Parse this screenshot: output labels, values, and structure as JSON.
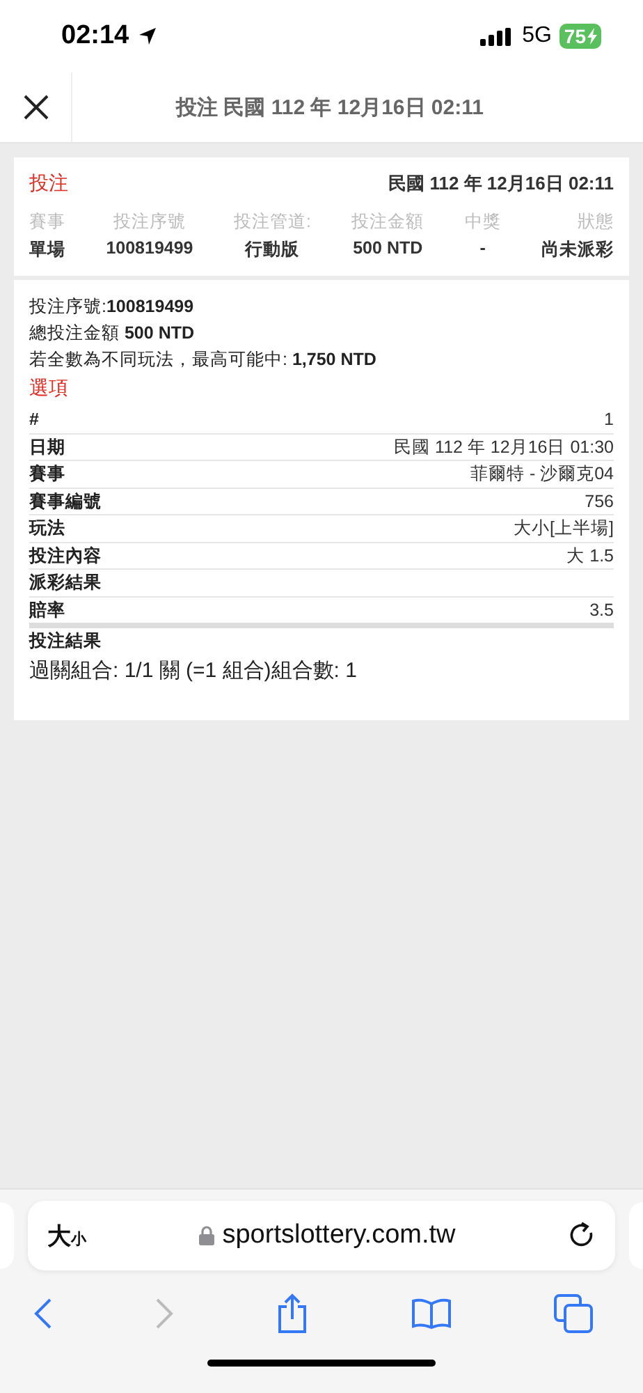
{
  "status_bar": {
    "time": "02:14",
    "network": "5G",
    "battery": "75"
  },
  "header": {
    "title": "投注 民國 112 年 12月16日 02:11"
  },
  "summary": {
    "title": "投注",
    "datetime": "民國 112 年 12月16日 02:11",
    "columns": [
      {
        "label": "賽事",
        "value": "單場"
      },
      {
        "label": "投注序號",
        "value": "100819499"
      },
      {
        "label": "投注管道:",
        "value": "行動版"
      },
      {
        "label": "投注金額",
        "value": "500 NTD"
      },
      {
        "label": "中獎",
        "value": "-"
      },
      {
        "label": "狀態",
        "value": "尚未派彩"
      }
    ]
  },
  "details": {
    "lines": [
      "投注序號:**100819499**",
      "總投注金額 **500 NTD**",
      "若全數為不同玩法，最高可能中: **1,750 NTD**"
    ],
    "section_title": "選項",
    "rows": [
      {
        "label": "#",
        "value": "1"
      },
      {
        "label": "日期",
        "value": "民國 112 年 12月16日 01:30"
      },
      {
        "label": "賽事",
        "value": "菲爾特 - 沙爾克04"
      },
      {
        "label": "賽事編號",
        "value": "756"
      },
      {
        "label": "玩法",
        "value": "大小[上半場]"
      },
      {
        "label": "投注內容",
        "value": "大 1.5"
      },
      {
        "label": "派彩結果"
      },
      {
        "label": "賠率",
        "value": "3.5"
      }
    ],
    "result_label": "投注結果",
    "combination": "過關組合: 1/1 關 (=1 組合)組合數: 1"
  },
  "browser": {
    "text_size_large": "大",
    "text_size_small": "小",
    "url": "sportslottery.com.tw"
  }
}
